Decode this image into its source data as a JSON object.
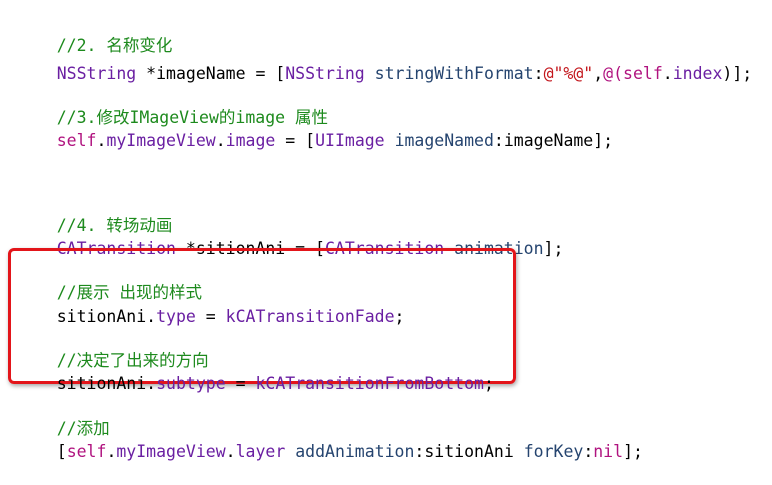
{
  "colors": {
    "comment": "#1d8a1d",
    "plain": "#000000",
    "class": "#6a1fa2",
    "keyword": "#b0137f",
    "method": "#25446f",
    "string": "#c3171d",
    "highlight_border": "#e3151a",
    "background": "#ffffff"
  },
  "code": {
    "line1": {
      "comment": "//2. 名称变化"
    },
    "line2": {
      "t1": "NSString",
      "t2": " *imageName = [",
      "t3": "NSString",
      "t4": " ",
      "t5": "stringWithFormat",
      "t6": ":",
      "t7": "@\"%@\"",
      "t8": ",",
      "t9": "@(",
      "t10": "self",
      "t11": ".",
      "t12": "index",
      "t13": ")];"
    },
    "line3": {
      "comment": "//3.修改IMageView的image 属性"
    },
    "line4": {
      "t1": "self",
      "t2": ".",
      "t3": "myImageView",
      "t4": ".",
      "t5": "image",
      "t6": " = [",
      "t7": "UIImage",
      "t8": " ",
      "t9": "imageNamed",
      "t10": ":imageName];"
    },
    "line5": {
      "comment": "//4. 转场动画"
    },
    "line6": {
      "t1": "CATransition",
      "t2": " *sitionAni = [",
      "t3": "CATransition",
      "t4": " ",
      "t5": "animation",
      "t6": "];"
    },
    "line7": {
      "comment": "//展示 出现的样式"
    },
    "line8": {
      "t1": "sitionAni.",
      "t2": "type",
      "t3": " = ",
      "t4": "kCATransitionFade",
      "t5": ";"
    },
    "line9": {
      "comment": "//决定了出来的方向"
    },
    "line10": {
      "t1": "sitionAni.",
      "t2": "subtype",
      "t3": " = ",
      "t4": "kCATransitionFromBottom",
      "t5": ";"
    },
    "line11": {
      "comment": "//添加"
    },
    "line12": {
      "t1": "[",
      "t2": "self",
      "t3": ".",
      "t4": "myImageView",
      "t5": ".",
      "t6": "layer",
      "t7": " ",
      "t8": "addAnimation",
      "t9": ":sitionAni ",
      "t10": "forKey",
      "t11": ":",
      "t12": "nil",
      "t13": "];"
    }
  }
}
